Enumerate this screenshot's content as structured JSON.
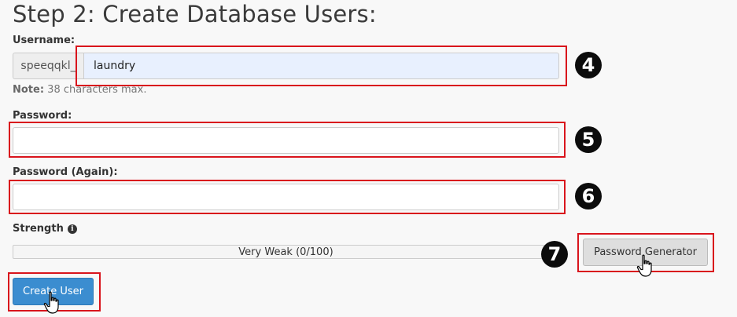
{
  "page": {
    "title": "Step 2: Create Database Users:"
  },
  "username": {
    "label": "Username:",
    "prefix": "speeqqkl_",
    "value": "laundry",
    "note_label": "Note:",
    "note_text": " 38 characters max."
  },
  "password": {
    "label": "Password:",
    "value": ""
  },
  "password_again": {
    "label": "Password (Again):",
    "value": ""
  },
  "strength": {
    "label": "Strength",
    "text": "Very Weak (0/100)",
    "score": 0,
    "max": 100,
    "info_icon": "info-circle-icon"
  },
  "buttons": {
    "password_generator": "Password Generator",
    "create_user": "Create User"
  },
  "annotations": {
    "step_4": "4",
    "step_5": "5",
    "step_6": "6",
    "step_7": "7"
  },
  "colors": {
    "highlight": "#d9141c",
    "primary_button": "#3b8dd0",
    "username_bg": "#e8f0fe"
  }
}
